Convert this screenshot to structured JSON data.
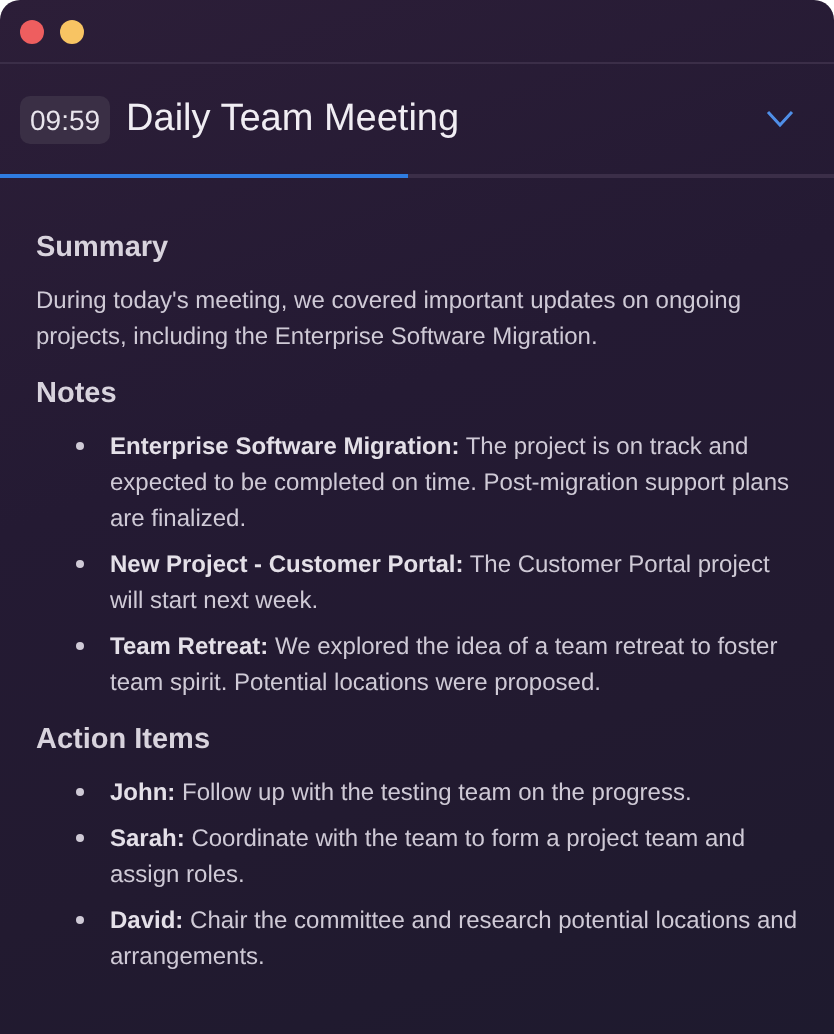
{
  "window": {
    "controls": [
      {
        "kind": "close"
      },
      {
        "kind": "minimize"
      }
    ]
  },
  "header": {
    "timer": "09:59",
    "title": "Daily Team Meeting",
    "expanded": false,
    "progress": {
      "level": 0.49
    }
  },
  "sections": [
    {
      "heading": "Summary",
      "kind": "paragraph",
      "text": "During today's meeting, we covered important updates on ongoing projects, including the Enterprise Software Migration."
    },
    {
      "heading": "Notes",
      "kind": "list",
      "items": [
        "**Enterprise Software Migration:** The project is on track and expected to be completed on time. Post-migration support plans are finalized.",
        "**New Project - Customer Portal:** The Customer Portal project will start next week.",
        "**Team Retreat:** We explored the idea of a team retreat to foster team spirit. Potential locations were proposed."
      ]
    },
    {
      "heading": "Action Items",
      "kind": "list",
      "items": [
        "**John:** Follow up with the testing team on the progress.",
        "**Sarah:** Coordinate with the team to form a project team and assign roles.",
        "**David:** Chair the committee and research potential locations and arrangements."
      ]
    }
  ]
}
